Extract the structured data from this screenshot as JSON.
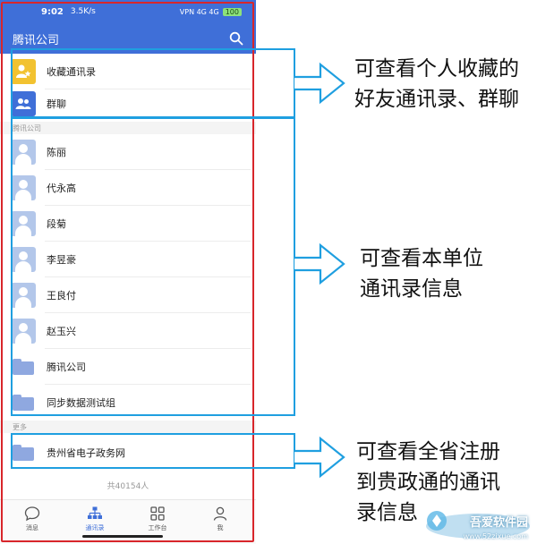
{
  "status_bar": {
    "time": "9:02",
    "speed": "3.5K/s",
    "signal": "VPN 4G 4G",
    "battery": "100"
  },
  "header": {
    "title": "腾讯公司",
    "search_icon": "search-icon"
  },
  "colors": {
    "brand": "#3f6fd8",
    "highlight": "#1f9fe0",
    "frame": "#d8262b",
    "favorite": "#f2c230"
  },
  "top_rows": [
    {
      "label": "收藏通讯录",
      "icon": "star-user-icon"
    },
    {
      "label": "群聊",
      "icon": "group-icon"
    }
  ],
  "section_company": "腾讯公司",
  "contacts": [
    {
      "label": "陈丽"
    },
    {
      "label": "代永高"
    },
    {
      "label": "段菊"
    },
    {
      "label": "李昱豪"
    },
    {
      "label": "王良付"
    },
    {
      "label": "赵玉兴"
    }
  ],
  "folders": [
    {
      "label": "腾讯公司"
    },
    {
      "label": "同步数据测试组"
    }
  ],
  "section_more": "更多",
  "more_rows": [
    {
      "label": "贵州省电子政务网"
    }
  ],
  "total_count": "共40154人",
  "bottom_nav": [
    {
      "label": "消息",
      "icon": "chat-icon"
    },
    {
      "label": "通讯录",
      "icon": "org-chart-icon",
      "active": true
    },
    {
      "label": "工作台",
      "icon": "grid-icon"
    },
    {
      "label": "我",
      "icon": "person-icon"
    }
  ],
  "annotations": {
    "a1_line1": "可查看个人收藏的",
    "a1_line2": "好友通讯录、群聊",
    "a2_line1": "可查看本单位",
    "a2_line2": "通讯录信息",
    "a3_line1": "可查看全省注册",
    "a3_line2": "到贵政通的通讯",
    "a3_line3": "录信息"
  },
  "watermark": {
    "brand": "吾爱软件园",
    "url": "www.52zixue.com"
  }
}
